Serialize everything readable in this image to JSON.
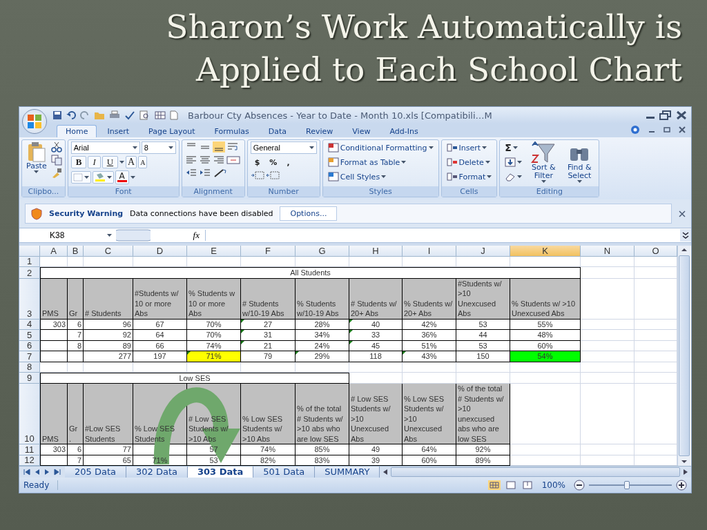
{
  "slide": {
    "title": "Sharon’s Work Automatically is Applied to Each School Chart"
  },
  "window": {
    "title": "Barbour Cty Absences - Year to Date - Month 10.xls  [Compatibili…M"
  },
  "ribbon_tabs": [
    {
      "label": "Home",
      "selected": true
    },
    {
      "label": "Insert",
      "selected": false
    },
    {
      "label": "Page Layout",
      "selected": false
    },
    {
      "label": "Formulas",
      "selected": false
    },
    {
      "label": "Data",
      "selected": false
    },
    {
      "label": "Review",
      "selected": false
    },
    {
      "label": "View",
      "selected": false
    },
    {
      "label": "Add-Ins",
      "selected": false
    }
  ],
  "clipboard": {
    "paste": "Paste",
    "label": "Clipbo..."
  },
  "font": {
    "name": "Arial",
    "size": "8",
    "styles": [
      "B",
      "I",
      "U"
    ],
    "grow": "A",
    "shrink": "A",
    "color_letter": "A",
    "label": "Font"
  },
  "alignment": {
    "label": "Alignment"
  },
  "number": {
    "format": "General",
    "symbols": [
      "$",
      "%",
      ","
    ],
    "label": "Number"
  },
  "styles": {
    "items": [
      "Conditional Formatting",
      "Format as Table",
      "Cell Styles"
    ],
    "label": "Styles"
  },
  "cells": {
    "items": [
      "Insert",
      "Delete",
      "Format"
    ],
    "label": "Cells"
  },
  "editing": {
    "sum": "Σ",
    "items": [
      "Sort & Filter",
      "Find & Select"
    ],
    "label": "Editing"
  },
  "security_bar": {
    "title": "Security Warning",
    "message": "Data connections have been disabled",
    "button": "Options..."
  },
  "formula_bar": {
    "name_box": "K38",
    "fx": "fx"
  },
  "sheet": {
    "columns": [
      {
        "label": "A",
        "selected": false
      },
      {
        "label": "B",
        "selected": false
      },
      {
        "label": "C",
        "selected": false
      },
      {
        "label": "D",
        "selected": false
      },
      {
        "label": "E",
        "selected": false
      },
      {
        "label": "F",
        "selected": false
      },
      {
        "label": "G",
        "selected": false
      },
      {
        "label": "H",
        "selected": false
      },
      {
        "label": "I",
        "selected": false
      },
      {
        "label": "J",
        "selected": false
      },
      {
        "label": "K",
        "selected": true
      },
      {
        "label": "N",
        "selected": false
      },
      {
        "label": "O",
        "selected": false
      }
    ],
    "rows": [
      {
        "number": "1",
        "kind": "blank"
      },
      {
        "number": "2",
        "kind": "title",
        "cells": [
          {
            "text": "All Students"
          }
        ]
      },
      {
        "number": "3",
        "kind": "header",
        "cells": [
          {
            "text": "PMS"
          },
          {
            "text": "Gr"
          },
          {
            "text": "# Students"
          },
          {
            "text": "#Students w/ 10 or more Abs"
          },
          {
            "text": "% Students w 10 or more Abs"
          },
          {
            "text": "# Students w/10-19 Abs"
          },
          {
            "text": "% Students w/10-19 Abs"
          },
          {
            "text": "# Students w/ 20+ Abs"
          },
          {
            "text": "% Students w/ 20+ Abs"
          },
          {
            "text": "#Students w/ >10 Unexcused Abs"
          },
          {
            "text": "% Students w/ >10 Unexcused Abs"
          }
        ]
      },
      {
        "number": "4",
        "kind": "data",
        "cells": [
          {
            "text": "303",
            "flagged": false
          },
          {
            "text": "6",
            "flagged": false
          },
          {
            "text": "96",
            "flagged": false
          },
          {
            "text": "67",
            "flagged": false
          },
          {
            "text": "70%",
            "flagged": false
          },
          {
            "text": "27",
            "flagged": true
          },
          {
            "text": "28%",
            "flagged": false
          },
          {
            "text": "40",
            "flagged": true
          },
          {
            "text": "42%",
            "flagged": false
          },
          {
            "text": "53",
            "flagged": false
          },
          {
            "text": "55%",
            "flagged": false
          }
        ]
      },
      {
        "number": "5",
        "kind": "data",
        "cells": [
          {
            "flagged": false
          },
          {
            "text": "7",
            "flagged": false
          },
          {
            "text": "92",
            "flagged": false
          },
          {
            "text": "64",
            "flagged": false
          },
          {
            "text": "70%",
            "flagged": false
          },
          {
            "text": "31",
            "flagged": true
          },
          {
            "text": "34%",
            "flagged": false
          },
          {
            "text": "33",
            "flagged": true
          },
          {
            "text": "36%",
            "flagged": false
          },
          {
            "text": "44",
            "flagged": false
          },
          {
            "text": "48%",
            "flagged": false
          }
        ]
      },
      {
        "number": "6",
        "kind": "data",
        "cells": [
          {
            "flagged": false
          },
          {
            "text": "8",
            "flagged": false
          },
          {
            "text": "89",
            "flagged": false
          },
          {
            "text": "66",
            "flagged": false
          },
          {
            "text": "74%",
            "flagged": false
          },
          {
            "text": "21",
            "flagged": true
          },
          {
            "text": "24%",
            "flagged": false
          },
          {
            "text": "45",
            "flagged": true
          },
          {
            "text": "51%",
            "flagged": false
          },
          {
            "text": "53",
            "flagged": false
          },
          {
            "text": "60%",
            "flagged": false
          }
        ]
      },
      {
        "number": "7",
        "kind": "data",
        "cells": [
          {
            "flagged": false
          },
          {
            "flagged": false
          },
          {
            "text": "277",
            "flagged": false
          },
          {
            "text": "197",
            "flagged": false
          },
          {
            "text": "71%",
            "flagged": true,
            "color": "#ffff00"
          },
          {
            "text": "79",
            "flagged": false
          },
          {
            "text": "29%",
            "flagged": true
          },
          {
            "text": "118",
            "flagged": false
          },
          {
            "text": "43%",
            "flagged": true
          },
          {
            "text": "150",
            "flagged": false
          },
          {
            "text": "54%",
            "flagged": false,
            "color": "#00ff00"
          }
        ]
      },
      {
        "number": "8",
        "kind": "blank"
      },
      {
        "number": "9",
        "kind": "title",
        "cells": [
          {
            "text": "Low SES"
          }
        ]
      },
      {
        "number": "10",
        "kind": "header",
        "cells": [
          {
            "text": "PMS"
          },
          {
            "text": "Gr ."
          },
          {
            "text": "#Low SES Students"
          },
          {
            "text": "% Low SES Students"
          },
          {
            "text": "# Low SES Students w/ >10 Abs"
          },
          {
            "text": "% Low SES Students w/ >10 Abs"
          },
          {
            "text": "% of the total # Students w/ >10 abs who are low SES"
          },
          {
            "text": "# Low SES Students w/ >10 Unexcused Abs"
          },
          {
            "text": "% Low SES Students w/ >10 Unexcused Abs"
          },
          {
            "text": "% of the total # Students w/ >10 unexcused abs who are low SES"
          }
        ]
      },
      {
        "number": "11",
        "kind": "data",
        "cells": [
          {
            "text": "303",
            "flagged": false
          },
          {
            "text": "6",
            "flagged": false
          },
          {
            "text": "77",
            "flagged": false
          },
          {
            "flagged": false
          },
          {
            "text": "57",
            "flagged": false
          },
          {
            "text": "74%",
            "flagged": false
          },
          {
            "text": "85%",
            "flagged": false
          },
          {
            "text": "49",
            "flagged": false
          },
          {
            "text": "64%",
            "flagged": false
          },
          {
            "text": "92%",
            "flagged": false
          }
        ]
      },
      {
        "number": "12",
        "kind": "data",
        "cells": [
          {
            "flagged": false
          },
          {
            "text": "7",
            "flagged": false
          },
          {
            "text": "65",
            "flagged": false
          },
          {
            "text": "71%",
            "flagged": false
          },
          {
            "text": "53",
            "flagged": false
          },
          {
            "text": "82%",
            "flagged": false
          },
          {
            "text": "83%",
            "flagged": false
          },
          {
            "text": "39",
            "flagged": false
          },
          {
            "text": "60%",
            "flagged": false
          },
          {
            "text": "89%",
            "flagged": false
          }
        ]
      }
    ]
  },
  "sheet_tabs": [
    {
      "label": "205 Data",
      "selected": false
    },
    {
      "label": "302 Data",
      "selected": false
    },
    {
      "label": "303 Data",
      "selected": true
    },
    {
      "label": "501 Data",
      "selected": false
    },
    {
      "label": "SUMMARY",
      "selected": false
    }
  ],
  "status_bar": {
    "status": "Ready",
    "zoom": "100%",
    "zoom_slider": {
      "level": 0.46
    }
  }
}
